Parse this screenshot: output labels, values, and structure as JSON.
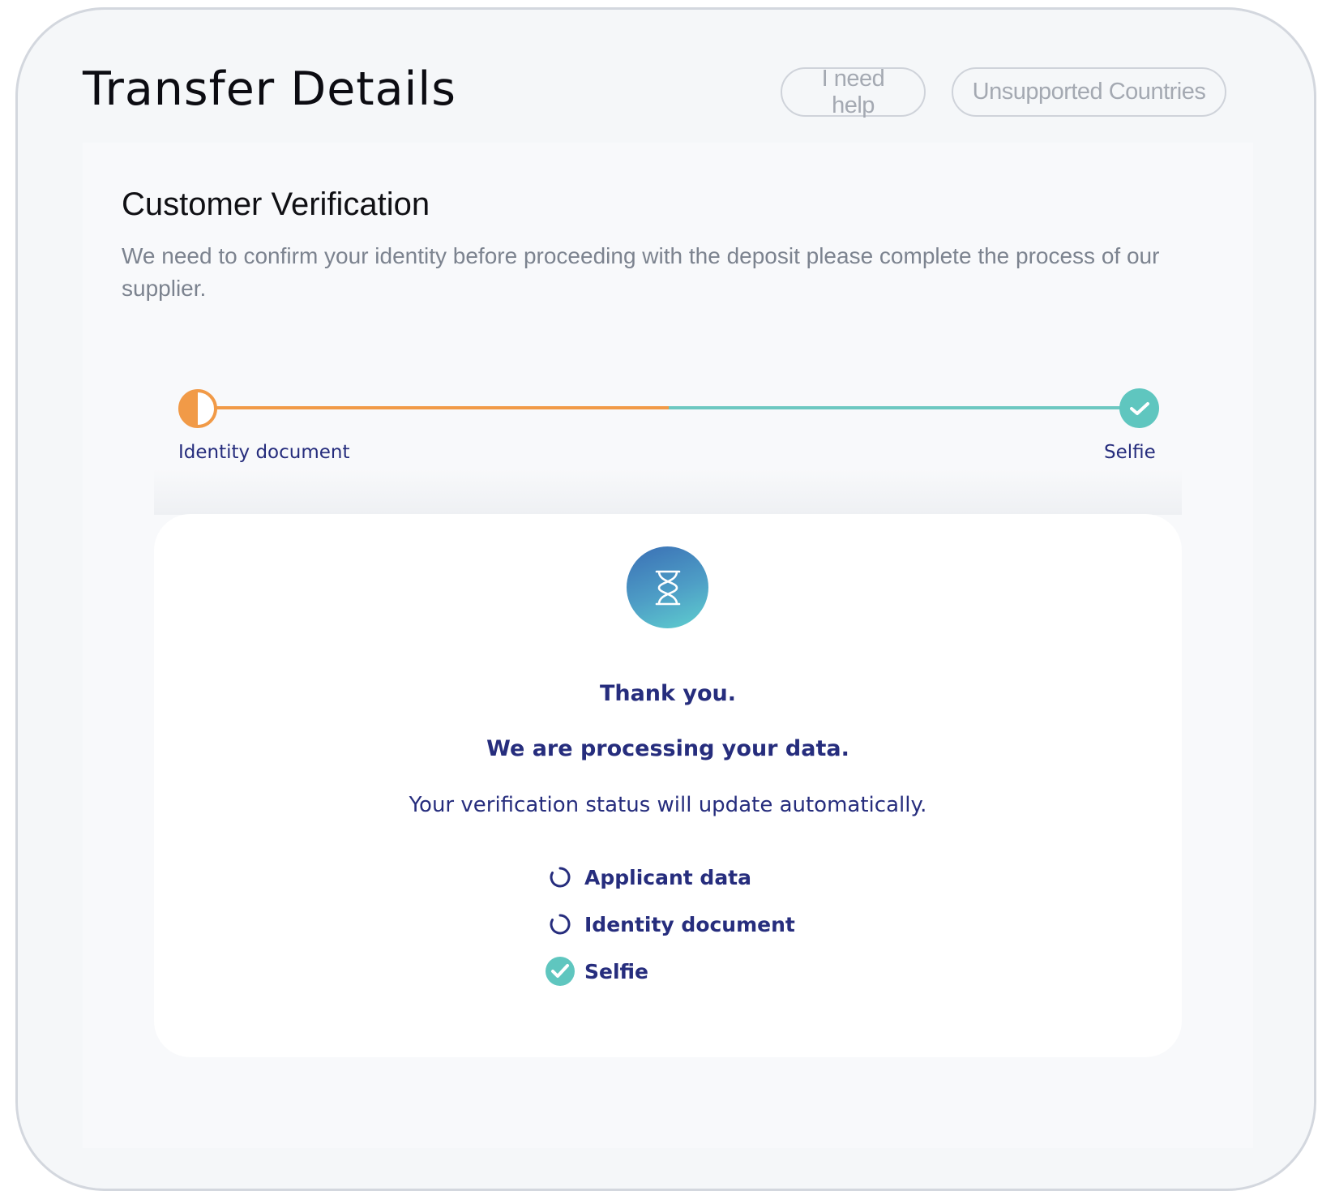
{
  "header": {
    "title": "Transfer Details",
    "help_label": "I need help",
    "countries_label": "Unsupported Countries"
  },
  "verification": {
    "title": "Customer Verification",
    "description": "We need to confirm your identity before proceeding with the deposit please complete the process of our supplier."
  },
  "stepper": {
    "steps": [
      {
        "label": "Identity document",
        "status": "in-progress",
        "color": "#f19a47"
      },
      {
        "label": "Selfie",
        "status": "complete",
        "color": "#5fc6bf"
      }
    ]
  },
  "status_card": {
    "icon": "hourglass-icon",
    "heading": "Thank you.",
    "subheading": "We are processing your data.",
    "note": "Your verification status will update automatically.",
    "checklist": [
      {
        "label": "Applicant data",
        "status": "pending",
        "icon": "spinner-icon"
      },
      {
        "label": "Identity document",
        "status": "pending",
        "icon": "spinner-icon"
      },
      {
        "label": "Selfie",
        "status": "done",
        "icon": "check-circle-icon"
      }
    ]
  },
  "colors": {
    "accent_orange": "#f19a47",
    "accent_teal": "#5fc6bf",
    "text_navy": "#262d7d"
  }
}
